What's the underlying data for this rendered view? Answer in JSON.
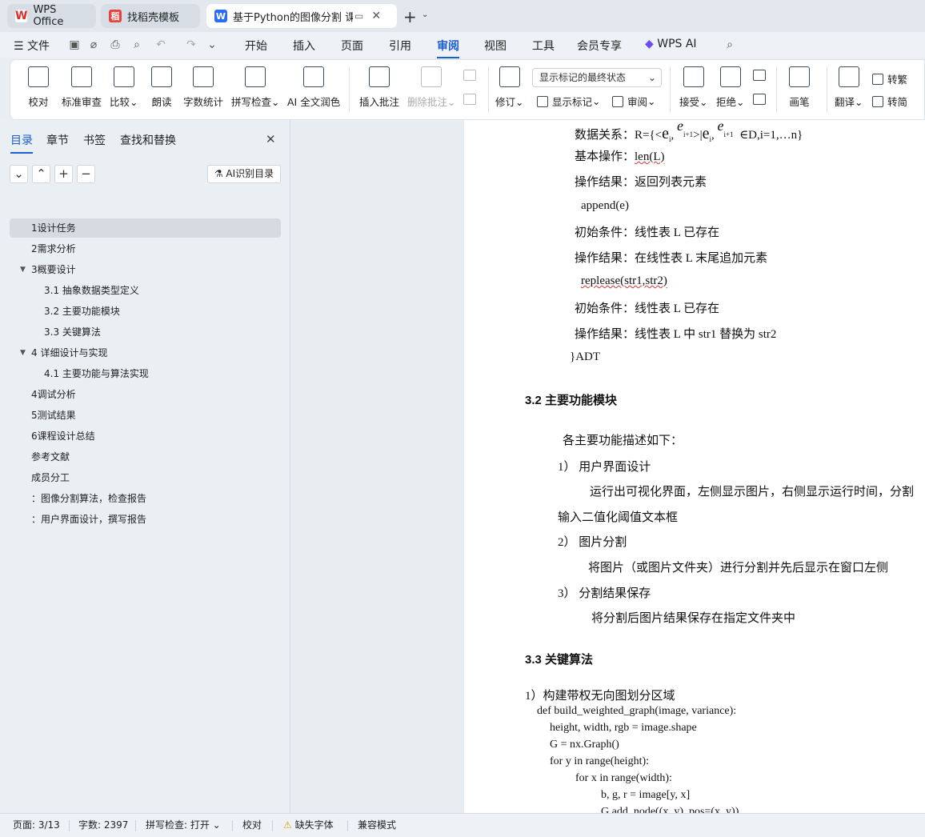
{
  "tabs": [
    {
      "label": "WPS Office"
    },
    {
      "label": "找稻壳模板"
    },
    {
      "label": "基于Python的图像分割 课程"
    }
  ],
  "menu": {
    "file": "文件",
    "items": [
      "开始",
      "插入",
      "页面",
      "引用",
      "审阅",
      "视图",
      "工具",
      "会员专享"
    ],
    "wps_ai": "WPS AI"
  },
  "ribbon": {
    "proofread": "校对",
    "std_review": "标准审查",
    "compare": "比较",
    "read": "朗读",
    "word_count": "字数统计",
    "spell": "拼写检查",
    "ai_polish": "AI 全文润色",
    "insert_comment": "插入批注",
    "delete_comment": "删除批注",
    "display_select": "显示标记的最终状态",
    "revise": "修订",
    "show_marks": "显示标记",
    "review": "审阅",
    "accept": "接受",
    "reject": "拒绝",
    "pen": "画笔",
    "translate": "翻译",
    "to_trad": "转繁",
    "to_simp": "转简"
  },
  "panel": {
    "tabs": [
      "目录",
      "章节",
      "书签",
      "查找和替换"
    ],
    "ai_toc": "AI识别目录",
    "toc": [
      "1设计任务",
      "2需求分析",
      "3概要设计",
      "3.1 抽象数据类型定义",
      "3.2  主要功能模块",
      "3.3  关键算法",
      "4   详细设计与实现",
      "4.1  主要功能与算法实现",
      "4调试分析",
      "5测试结果",
      "6课程设计总结",
      "参考文献",
      "成员分工",
      "：图像分割算法，检查报告",
      "：用户界面设计，撰写报告"
    ]
  },
  "doc": {
    "data_rel": "数据关系：R={<",
    "data_rel_tail": "∈D,i=1,…n}",
    "basic_op": "基本操作：",
    "len": "len(L)",
    "op_res1": "操作结果：返回列表元素",
    "append": "append(e)",
    "init1": "初始条件：线性表 L 已存在",
    "op_res2": "操作结果：在线性表 L 末尾追加元素",
    "replace": "replease(str1,str2)",
    "init2": "初始条件：线性表 L 已存在",
    "op_res3": "操作结果：线性表 L 中 str1 替换为 str2",
    "adt": "}ADT",
    "h32": "3.2  主要功能模块",
    "intro": "各主要功能描述如下：",
    "i1": "1）    用户界面设计",
    "i1d": "运行出可视化界面，左侧显示图片，右侧显示运行时间，分割",
    "i1d2": "输入二值化阈值文本框",
    "i2": "2）    图片分割",
    "i2d": "将图片（或图片文件夹）进行分割并先后显示在窗口左侧",
    "i3": "3）    分割结果保存",
    "i3d": "将分割后图片结果保存在指定文件夹中",
    "h33": "3.3  关键算法",
    "alg1": "1）构建带权无向图划分区域",
    "c1": "def build_weighted_graph(image, variance):",
    "c2": "height, width, rgb = image.shape",
    "c3": "G = nx.Graph()",
    "c4": "for y in range(height):",
    "c5": "for x in range(width):",
    "c6": "b, g, r = image[y, x]",
    "c7": "G.add_node((x, y), pos=(x, y))"
  },
  "status": {
    "page": "页面: 3/13",
    "words": "字数: 2397",
    "spell": "拼写检查: 打开",
    "proof": "校对",
    "missing_font": "缺失字体",
    "compat": "兼容模式"
  }
}
